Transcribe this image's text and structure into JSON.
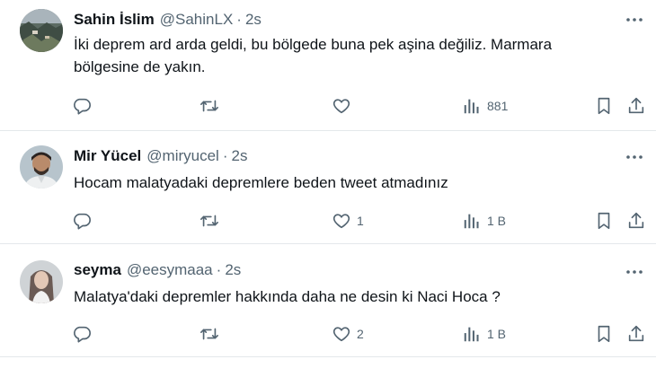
{
  "tweets": [
    {
      "name": "Sahin İslim",
      "handle": "@SahinLX",
      "dot": "·",
      "time": "2s",
      "text": "İki deprem ard arda geldi, bu bölgede buna pek aşina değiliz. Marmara bölgesine de yakın.",
      "likes": "",
      "views": "881"
    },
    {
      "name": "Mir Yücel",
      "handle": "@miryucel",
      "dot": "·",
      "time": "2s",
      "text": "Hocam malatyadaki depremlere beden tweet atmadınız",
      "likes": "1",
      "views": "1 B"
    },
    {
      "name": "seyma",
      "handle": "@eesymaaa",
      "dot": "·",
      "time": "2s",
      "text": "Malatya'daki depremler hakkında daha ne desin ki Naci Hoca ?",
      "likes": "2",
      "views": "1 B"
    }
  ],
  "colors": {
    "text_primary": "#0f1419",
    "text_secondary": "#536471",
    "divider": "#e4e8eb"
  },
  "icons": [
    "more-icon",
    "reply-icon",
    "retweet-icon",
    "like-icon",
    "views-icon",
    "bookmark-icon",
    "share-icon"
  ]
}
